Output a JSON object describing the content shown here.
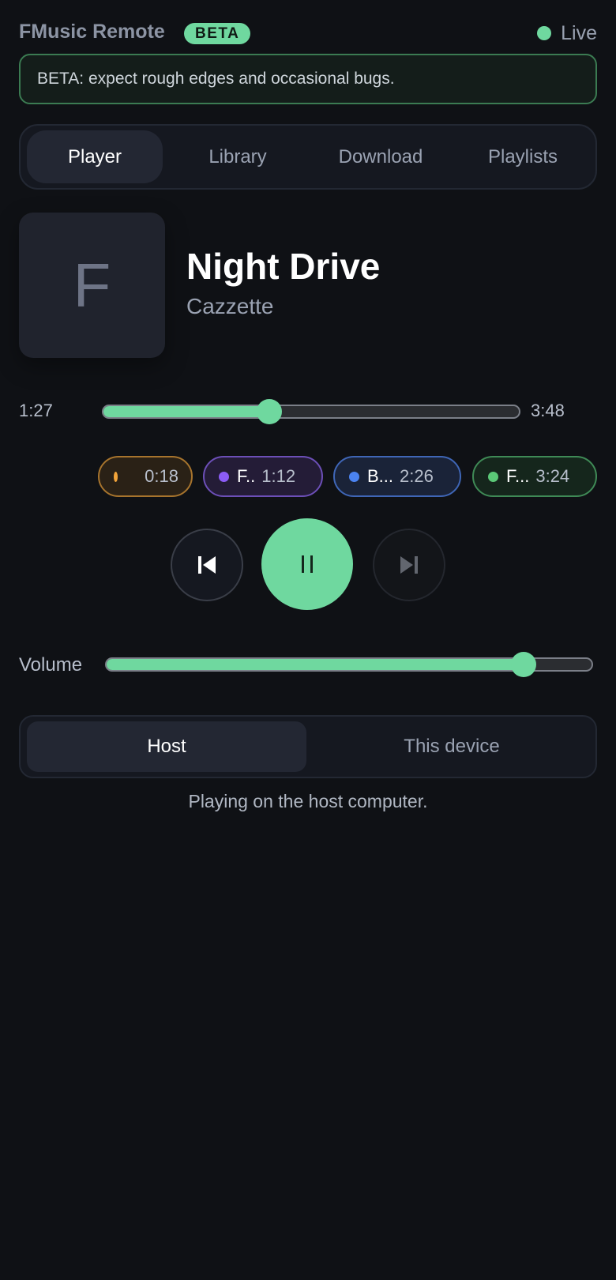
{
  "header": {
    "app_title": "FMusic Remote",
    "badge": "BETA",
    "status_label": "Live",
    "status_color": "#6fd89f"
  },
  "notice": {
    "text": "BETA: expect rough edges and occasional bugs."
  },
  "tabs": [
    {
      "label": "Player",
      "active": true
    },
    {
      "label": "Library",
      "active": false
    },
    {
      "label": "Download",
      "active": false
    },
    {
      "label": "Playlists",
      "active": false
    }
  ],
  "track": {
    "cover_letter": "F",
    "title": "Night Drive",
    "artist": "Cazzette"
  },
  "progress": {
    "elapsed": "1:27",
    "total": "3:48",
    "fraction": 0.4
  },
  "markers": [
    {
      "name": "",
      "time": "0:18",
      "color": "#f2a43a"
    },
    {
      "name": "F..",
      "time": "1:12",
      "color": "#8b5cf6"
    },
    {
      "name": "B...",
      "time": "2:26",
      "color": "#4b83f0"
    },
    {
      "name": "F...",
      "time": "3:24",
      "color": "#5bc877"
    }
  ],
  "controls": {
    "previous_icon": "skip-previous-icon",
    "play_pause_icon": "pause-icon",
    "next_icon": "skip-next-icon",
    "accent": "#6fd89f"
  },
  "volume": {
    "label": "Volume",
    "fraction": 0.86
  },
  "output": {
    "options": [
      {
        "label": "Host",
        "active": true
      },
      {
        "label": "This device",
        "active": false
      }
    ],
    "status": "Playing on the host computer."
  }
}
